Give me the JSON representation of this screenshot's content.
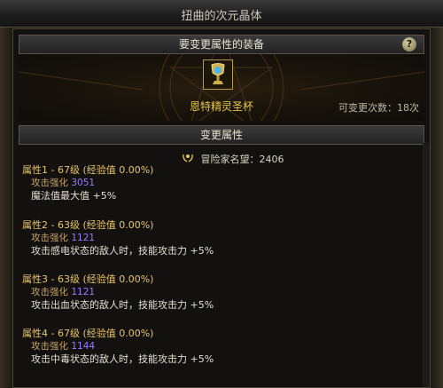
{
  "window": {
    "title": "扭曲的次元晶体"
  },
  "equip_section": {
    "header": "要变更属性的装备",
    "help": "?",
    "item_name": "恩特精灵圣杯",
    "change_count_label": "可变更次数：18次"
  },
  "change_section": {
    "header": "变更属性",
    "reputation": "冒险家名望：2406"
  },
  "attributes": [
    {
      "title": "属性1 - 67级 (经验值 0.00%)",
      "sub_label": "攻击强化",
      "sub_value": "3051",
      "effect": "魔法值最大值 +5%"
    },
    {
      "title": "属性2 - 63级 (经验值 0.00%)",
      "sub_label": "攻击强化",
      "sub_value": "1121",
      "effect": "攻击感电状态的敌人时，技能攻击力 +5%"
    },
    {
      "title": "属性3 - 63级 (经验值 0.00%)",
      "sub_label": "攻击强化",
      "sub_value": "1121",
      "effect": "攻击出血状态的敌人时，技能攻击力 +5%"
    },
    {
      "title": "属性4 - 67级 (经验值 0.00%)",
      "sub_label": "攻击强化",
      "sub_value": "1144",
      "effect": "攻击中毒状态的敌人时，技能攻击力 +5%"
    }
  ],
  "colors": {
    "gold": "#e8c74a",
    "purple_value": "#9c7bff"
  },
  "icons": [
    "question-icon",
    "laurel-icon",
    "grail-item-icon"
  ]
}
